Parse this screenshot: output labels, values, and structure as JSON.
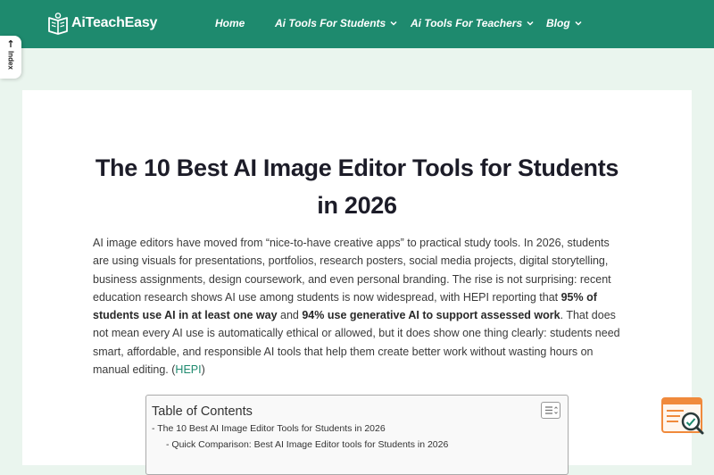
{
  "brand": {
    "name": "AiTeachEasy"
  },
  "nav": {
    "items": [
      {
        "label": "Home",
        "has_dropdown": false
      },
      {
        "label": "Ai Tools For Students",
        "has_dropdown": true
      },
      {
        "label": "Ai Tools For Teachers",
        "has_dropdown": true
      },
      {
        "label": "Blog",
        "has_dropdown": true
      }
    ]
  },
  "index_tab": {
    "arrow": "↑",
    "label": "Index"
  },
  "article": {
    "title": "The 10 Best AI Image Editor Tools for Students in 2026",
    "intro": {
      "p1": "AI image editors have moved from “nice-to-have creative apps” to practical study tools. In 2026, students are using visuals for presentations, portfolios, research posters, social media projects, digital storytelling, business assignments, design coursework, and even personal branding. The rise is not surprising: recent education research shows AI use among students is now widespread, with HEPI reporting that ",
      "b1": "95% of students use AI in at least one way",
      "p2": " and ",
      "b2": "94% use generative AI to support assessed work",
      "p3": ". That does not mean every AI use is automatically ethical or allowed, but it does show one thing clearly: students need smart, affordable, and responsible AI tools that help them create better work without wasting hours on manual editing. (",
      "link": "HEPI",
      "p4": ")"
    }
  },
  "toc": {
    "title": "Table of Contents",
    "items": [
      {
        "label": "- The 10 Best AI Image Editor Tools for Students in 2026",
        "level": 1
      },
      {
        "label": "- Quick Comparison: Best AI Image Editor tools for Students in 2026",
        "level": 2
      }
    ]
  },
  "colors": {
    "header": "#1e8a6e",
    "background": "#eaf5ee",
    "accent": "#1e8a6e",
    "widget": "#f08a3c"
  },
  "icons": {
    "logo": "open-book-icon",
    "dropdown": "chevron-down-icon",
    "toc_toggle": "list-toggle-icon",
    "search_widget": "search-magnifier-icon"
  }
}
